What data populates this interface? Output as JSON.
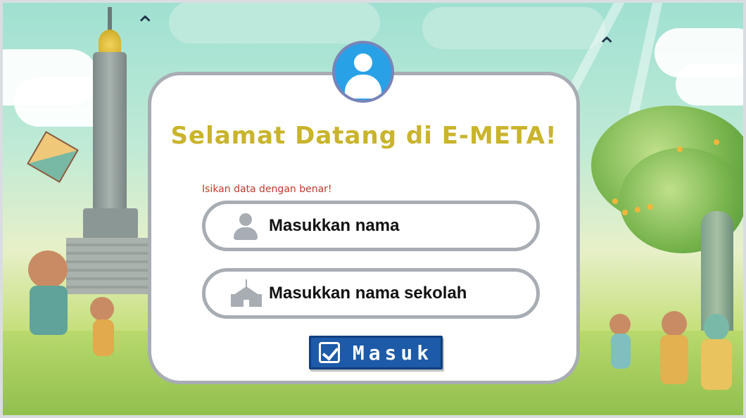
{
  "welcome_title": "Selamat Datang di E-META!",
  "hint": "Isikan data dengan benar!",
  "fields": {
    "name_placeholder": "Masukkan nama",
    "school_placeholder": "Masukkan nama sekolah"
  },
  "submit_label": "Masuk",
  "icons": {
    "avatar": "user-avatar-icon",
    "name": "person-icon",
    "school": "school-building-icon",
    "submit": "checkbox-icon"
  },
  "colors": {
    "title": "#c9b42c",
    "hint": "#c0392b",
    "button": "#1d5aa8",
    "avatar": "#29a1e6",
    "field_border": "#a7adb3"
  }
}
